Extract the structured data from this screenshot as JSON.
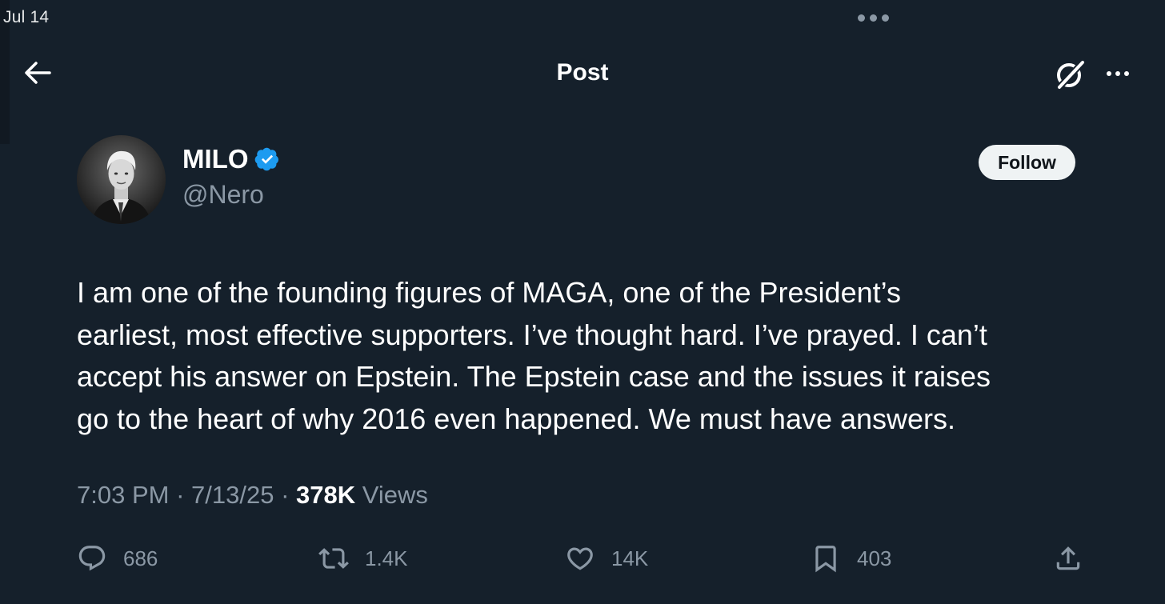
{
  "status_bar": {
    "date": "Jul 14"
  },
  "header": {
    "title": "Post"
  },
  "author": {
    "display_name": "MILO",
    "handle": "@Nero",
    "verified": true
  },
  "follow_button": {
    "label": "Follow"
  },
  "post": {
    "text": "I am one of the founding figures of MAGA, one of the President’s\nearliest, most effective supporters. I’ve thought hard. I’ve prayed. I can’t\naccept his answer on Epstein. The Epstein case and the issues it raises\ngo to the heart of why 2016 even happened. We must have answers.",
    "time": "7:03 PM",
    "date": "7/13/25",
    "separator": "·",
    "views_count": "378K",
    "views_label": "Views"
  },
  "actions": {
    "replies": "686",
    "reposts": "1.4K",
    "likes": "14K",
    "bookmarks": "403"
  },
  "colors": {
    "background": "#15202b",
    "secondary_text": "#8b98a5",
    "verified_badge": "#1d9bf0",
    "follow_button_bg": "#eff3f4"
  },
  "icons": [
    "arrow-left-icon",
    "grok-icon",
    "more-horizontal-icon",
    "verified-badge-icon",
    "reply-icon",
    "repost-icon",
    "heart-icon",
    "bookmark-icon",
    "share-icon"
  ]
}
